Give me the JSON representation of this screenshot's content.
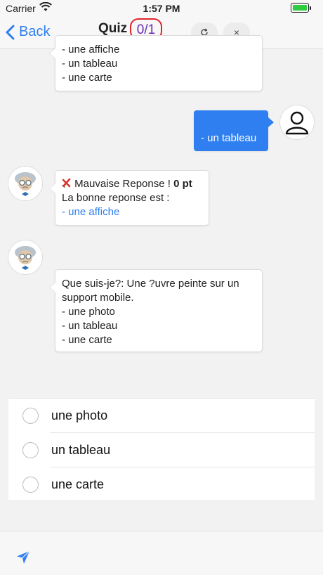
{
  "status_bar": {
    "carrier": "Carrier",
    "time": "1:57 PM"
  },
  "nav": {
    "back_label": "Back",
    "title": "Quiz",
    "score": "0/1",
    "refresh_icon": "refresh-icon",
    "close_label": "×"
  },
  "chat": {
    "bot_prev_question": {
      "lines": [
        "- une affiche",
        "- un tableau",
        "- une carte"
      ]
    },
    "user_answer": "- un tableau",
    "feedback": {
      "icon": "cross-mark-icon",
      "result_text": "Mauvaise Reponse !",
      "points": "0 pt",
      "correct_intro": "La bonne reponse est :",
      "correct_answer": "- une affiche"
    },
    "bot_question": {
      "lines": [
        "Que suis-je?: Une ?uvre peinte sur un",
        "support mobile.",
        "- une photo",
        "- un tableau",
        "- une carte"
      ]
    }
  },
  "options": [
    {
      "label": "une photo"
    },
    {
      "label": "un tableau"
    },
    {
      "label": "une carte"
    }
  ],
  "colors": {
    "accent": "#2f7ff0",
    "score_ring": "#e0242a",
    "score_text": "#6a2ab5"
  }
}
